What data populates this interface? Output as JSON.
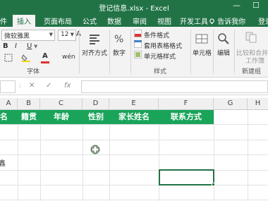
{
  "window": {
    "title": "登记信息.xlsx - Excel",
    "controls": {
      "minimize": "—",
      "maximize": "☐"
    }
  },
  "tabs": {
    "items": [
      {
        "label": "件"
      },
      {
        "label": "插入"
      },
      {
        "label": "页面布局"
      },
      {
        "label": "公式"
      },
      {
        "label": "数据"
      },
      {
        "label": "审阅"
      },
      {
        "label": "视图"
      },
      {
        "label": "开发工具"
      }
    ],
    "tell_me": "告诉我你",
    "login": "登录"
  },
  "ribbon": {
    "font_name": "微软雅黑",
    "font_size": "12",
    "bold": "B",
    "italic": "I",
    "underline": "U",
    "font_group_label": "字体",
    "alignment_label": "对齐方式",
    "number_label": "数字",
    "conditional_format": "条件格式",
    "table_format": "套用表格格式",
    "cell_styles": "单元格样式",
    "styles_group_label": "样式",
    "cells_label": "单元格",
    "editing_label": "编辑",
    "merge_label_line1": "比较和合并",
    "merge_label_line2": "工作簿",
    "new_group_label": "新建组",
    "font_color": "A",
    "grow_font": "A",
    "accent_color": "#217346"
  },
  "formula_bar": {
    "cancel": "✕",
    "enter": "✓",
    "fx": "fx",
    "value": ""
  },
  "grid": {
    "columns": [
      "A",
      "B",
      "C",
      "D",
      "E",
      "F",
      "G",
      "H"
    ],
    "header_cells": [
      "名",
      "籍贯",
      "年龄",
      "性别",
      "家长姓名",
      "联系方式"
    ],
    "partial_row_text": "鑫",
    "header_fill": "#1aa45a"
  }
}
